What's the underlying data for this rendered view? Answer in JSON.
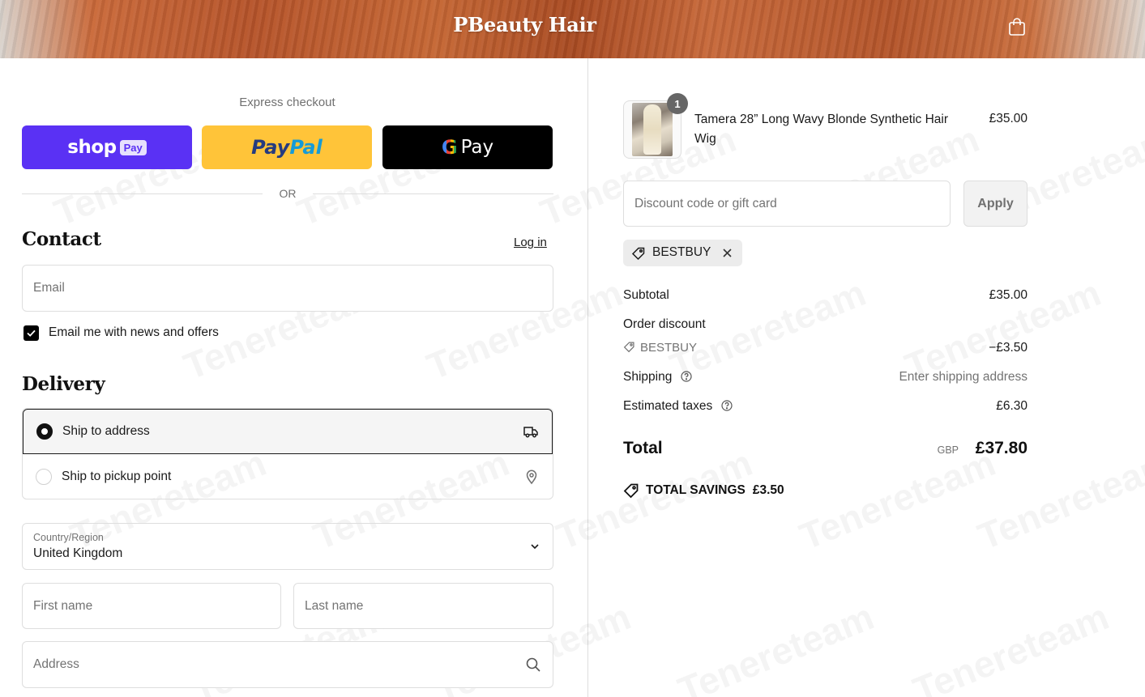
{
  "header": {
    "store_name": "PBeauty Hair",
    "cart_icon": "shopping-bag-icon"
  },
  "express": {
    "title": "Express checkout",
    "shop_pay": {
      "wordmark": "shop",
      "chip": "Pay",
      "color": "#5a31f4"
    },
    "paypal": {
      "pay": "Pay",
      "pal": "Pal",
      "color": "#ffc439"
    },
    "gpay": {
      "g": "G",
      "label": "Pay",
      "color": "#000000"
    },
    "or_label": "OR"
  },
  "contact": {
    "title": "Contact",
    "login_label": "Log in",
    "email_placeholder": "Email",
    "newsletter_label": "Email me with news and offers",
    "newsletter_checked": true
  },
  "delivery": {
    "title": "Delivery",
    "options": [
      {
        "label": "Ship to address",
        "selected": true,
        "icon": "truck-icon"
      },
      {
        "label": "Ship to pickup point",
        "selected": false,
        "icon": "map-pin-icon"
      }
    ],
    "country_label": "Country/Region",
    "country_value": "United Kingdom",
    "first_name_placeholder": "First name",
    "last_name_placeholder": "Last name",
    "address_placeholder": "Address"
  },
  "order": {
    "item": {
      "name": "Tamera 28” Long Wavy Blonde Synthetic Hair Wig",
      "price": "£35.00",
      "quantity": "1"
    },
    "discount_placeholder": "Discount code or gift card",
    "apply_label": "Apply",
    "applied_code": "BESTBUY",
    "subtotal_label": "Subtotal",
    "subtotal_value": "£35.00",
    "order_discount_label": "Order discount",
    "order_discount_code": "BESTBUY",
    "order_discount_value": "−£3.50",
    "shipping_label": "Shipping",
    "shipping_value": "Enter shipping address",
    "taxes_label": "Estimated taxes",
    "taxes_value": "£6.30",
    "total_label": "Total",
    "total_currency": "GBP",
    "total_value": "£37.80",
    "savings_label": "TOTAL SAVINGS",
    "savings_value": "£3.50"
  },
  "watermark": "Tenereteam"
}
